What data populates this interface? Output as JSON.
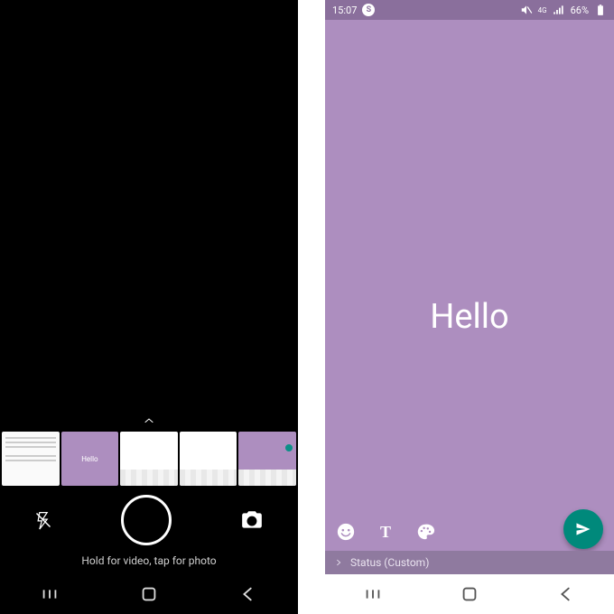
{
  "left": {
    "hint": "Hold for video, tap for photo",
    "thumbs": {
      "purple_text": "Hello"
    }
  },
  "right": {
    "status_bar": {
      "time": "15:07",
      "carrier_badge": "S",
      "network_label": "4G",
      "battery_pct": "66%"
    },
    "composer": {
      "text": "Hello"
    },
    "tools": {
      "font_glyph": "T"
    },
    "footer": {
      "label": "Status (Custom)"
    }
  }
}
